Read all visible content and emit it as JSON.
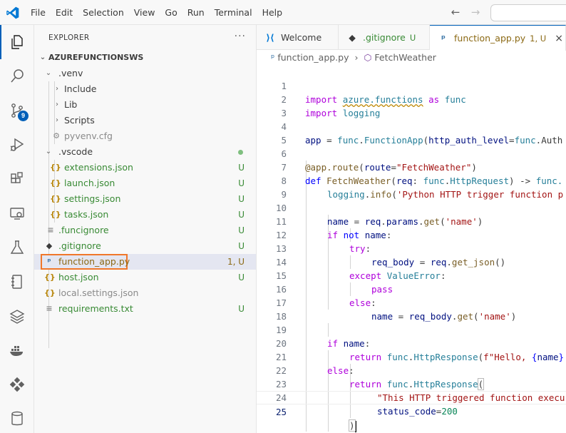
{
  "menu": [
    "File",
    "Edit",
    "Selection",
    "View",
    "Go",
    "Run",
    "Terminal",
    "Help"
  ],
  "activity": {
    "source_control_badge": "9"
  },
  "explorer": {
    "title": "EXPLORER",
    "more": "···",
    "root": "AZUREFUNCTIONSWS",
    "items": [
      {
        "name": ".venv",
        "deco": ""
      },
      {
        "name": "Include",
        "deco": ""
      },
      {
        "name": "Lib",
        "deco": ""
      },
      {
        "name": "Scripts",
        "deco": ""
      },
      {
        "name": "pyvenv.cfg",
        "deco": ""
      },
      {
        "name": ".vscode",
        "deco": ""
      },
      {
        "name": "extensions.json",
        "deco": "U"
      },
      {
        "name": "launch.json",
        "deco": "U"
      },
      {
        "name": "settings.json",
        "deco": "U"
      },
      {
        "name": "tasks.json",
        "deco": "U"
      },
      {
        "name": ".funcignore",
        "deco": "U"
      },
      {
        "name": ".gitignore",
        "deco": "U"
      },
      {
        "name": "function_app.py",
        "deco": "1, U"
      },
      {
        "name": "host.json",
        "deco": "U"
      },
      {
        "name": "local.settings.json",
        "deco": ""
      },
      {
        "name": "requirements.txt",
        "deco": "U"
      }
    ]
  },
  "tabs": [
    {
      "label": "Welcome",
      "deco": ""
    },
    {
      "label": ".gitignore",
      "deco": "U"
    },
    {
      "label": "function_app.py",
      "deco": "1, U",
      "close": "×"
    }
  ],
  "breadcrumb": {
    "file": "function_app.py",
    "symbol": "FetchWeather",
    "sep": "›"
  },
  "code": {
    "line_numbers": [
      "1",
      "2",
      "3",
      "4",
      "5",
      "6",
      "7",
      "8",
      "9",
      "10",
      "11",
      "12",
      "13",
      "14",
      "15",
      "16",
      "17",
      "18",
      "19",
      "20",
      "21",
      "22",
      "23",
      "24",
      "25"
    ],
    "l1": [
      "import",
      "azure.functions",
      "as",
      "func"
    ],
    "l2": [
      "import",
      "logging"
    ],
    "l4": [
      "app",
      "=",
      "func",
      ".",
      "FunctionApp",
      "(",
      "http_auth_level",
      "=",
      "func",
      ".Auth"
    ],
    "l6": [
      "@",
      "app",
      ".",
      "route",
      "(",
      "route",
      "=",
      "\"FetchWeather\"",
      ")"
    ],
    "l7": [
      "def",
      "FetchWeather",
      "(",
      "req",
      ":",
      "func",
      ".",
      "HttpRequest",
      ")",
      "->",
      "func."
    ],
    "l8": [
      "logging",
      ".",
      "info",
      "(",
      "'Python HTTP trigger function p"
    ],
    "l10": [
      "name",
      "=",
      "req",
      ".",
      "params",
      ".",
      "get",
      "(",
      "'name'",
      ")"
    ],
    "l11": [
      "if",
      "not",
      "name",
      ":"
    ],
    "l12": [
      "try",
      ":"
    ],
    "l13": [
      "req_body",
      "=",
      "req",
      ".",
      "get_json",
      "()"
    ],
    "l14": [
      "except",
      "ValueError",
      ":"
    ],
    "l15": [
      "pass"
    ],
    "l16": [
      "else",
      ":"
    ],
    "l17": [
      "name",
      "=",
      "req_body",
      ".",
      "get",
      "(",
      "'name'",
      ")"
    ],
    "l19": [
      "if",
      "name",
      ":"
    ],
    "l20": [
      "return",
      "func",
      ".",
      "HttpResponse",
      "(",
      "f\"Hello, ",
      "{",
      "name",
      "}"
    ],
    "l21": [
      "else",
      ":"
    ],
    "l22": [
      "return",
      "func",
      ".",
      "HttpResponse",
      "("
    ],
    "l23": [
      "\"This HTTP triggered function execu"
    ],
    "l24": [
      "status_code",
      "=",
      "200"
    ],
    "l25": [
      ")"
    ]
  }
}
